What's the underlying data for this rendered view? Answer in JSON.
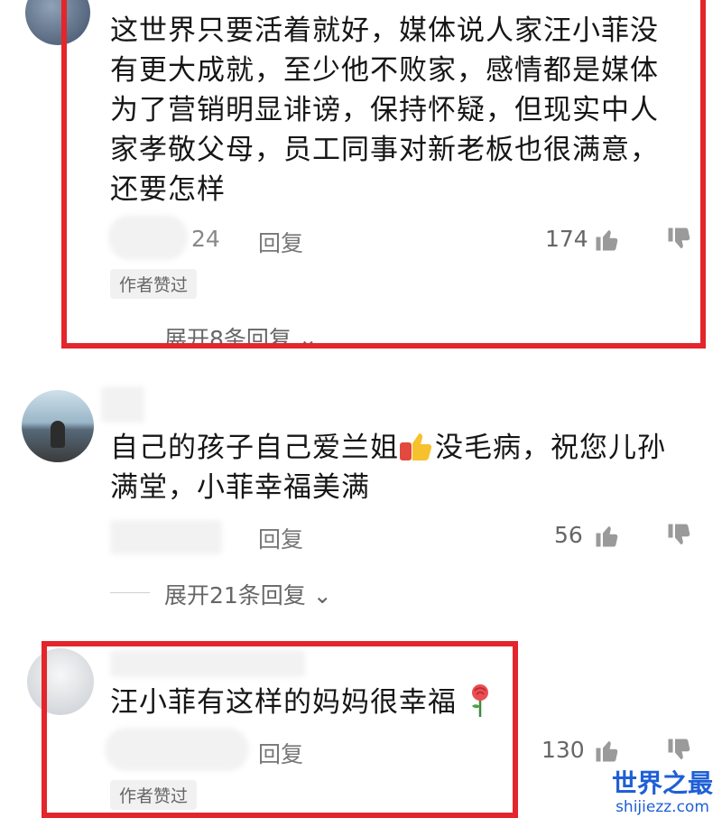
{
  "comments": [
    {
      "text_lines": [
        "这世界只要活着就好，媒体说人家汪小菲没",
        "有更大成就，至少他不败家，感情都是媒体",
        "为了营销明显诽谤，保持怀疑，但现实中人",
        "家孝敬父母，员工同事对新老板也很满意，",
        "还要怎样"
      ],
      "meta": "24",
      "reply_label": "回复",
      "likes": "174",
      "badge": "作者赞过",
      "expand_label": "展开8条回复"
    },
    {
      "text_lines": [
        "自己的孩子自己爱兰姐",
        "没毛病，祝您儿孙",
        "满堂，小菲幸福美满"
      ],
      "reply_label": "回复",
      "likes": "56",
      "expand_label": "展开21条回复"
    },
    {
      "text": "汪小菲有这样的妈妈很幸福",
      "reply_label": "回复",
      "likes": "130",
      "badge": "作者赞过"
    }
  ],
  "watermark": {
    "brand": "世界之最",
    "url": "shijiezz.com"
  },
  "colors": {
    "highlight": "#e3262b",
    "watermark": "#1e5fd6"
  },
  "icons": [
    "thumbs-up-icon",
    "thumbs-down-icon",
    "chevron-down-icon",
    "rose-icon",
    "thumbs-up-emoji"
  ]
}
